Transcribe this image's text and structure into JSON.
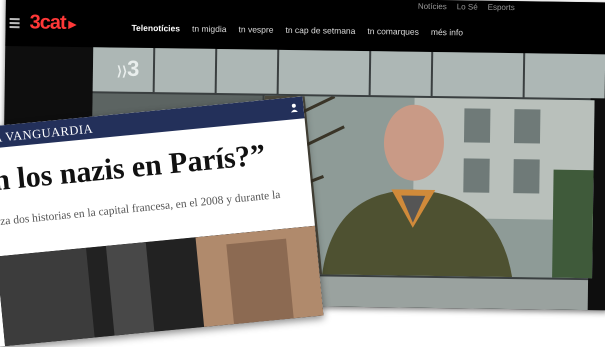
{
  "site": {
    "logo_text": "3cat",
    "nav": [
      "Telenotícies",
      "tn migdia",
      "tn vespre",
      "tn cap de setmana",
      "tn comarques",
      "més info"
    ],
    "top_right": [
      "Notícies",
      "Lo Sé",
      "Esports"
    ],
    "watermark": "3",
    "accent_color": "#ff3838"
  },
  "article": {
    "brand": "A VANGUARDIA",
    "headline": "n los nazis en París?”",
    "subtext": "iza dos historias en la capital francesa, en el 2008 y durante la",
    "header_color": "#23305a"
  }
}
